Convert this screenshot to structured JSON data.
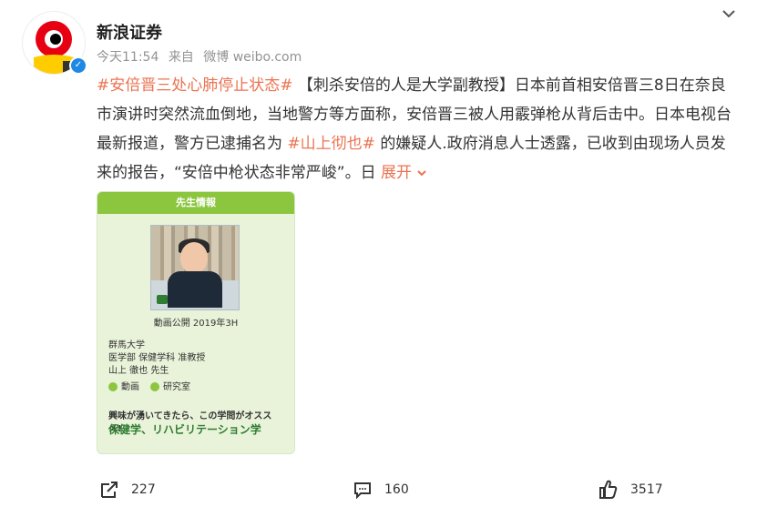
{
  "post": {
    "author": "新浪证券",
    "meta": {
      "time": "今天11:54",
      "source_prefix": "来自",
      "source": "微博 weibo.com"
    },
    "text": {
      "topic1": "#安倍晋三处心肺停止状态#",
      "body1": "【刺杀安倍的人是大学副教授】日本前首相安倍晋三8日在奈良市演讲时突然流血倒地，当地警方等方面称，安倍晋三被人用霰弹枪从背后击中。日本电视台最新报道，警方已逮捕名为",
      "topic2": "#山上彻也#",
      "body2": " 的嫌疑人.政府消息人士透露，已收到由现场人员发来的报告，“安倍中枪状态非常严峻”。日",
      "expand": "展开"
    },
    "image": {
      "title": "先生情報",
      "date": "動画公開 2019年3H",
      "lines": [
        "群馬大学",
        "医学部 保健学科 准教授",
        "山上 徹也 先生"
      ],
      "link_left": "動画",
      "link_right": "研究室",
      "cta": "興味が湧いてきたら、この学問がオススメ!",
      "cta_sub": "保健学、リハビリテーション学"
    },
    "actions": {
      "repost_count": "227",
      "comment_count": "160",
      "like_count": "3517"
    }
  }
}
